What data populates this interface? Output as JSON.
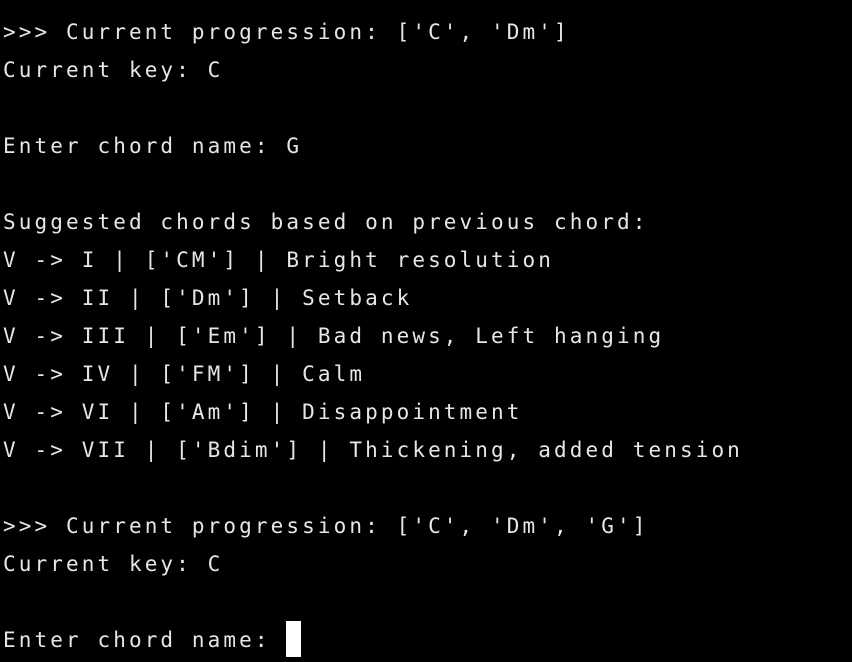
{
  "terminal": {
    "lines": [
      ">>> Current progression: ['C', 'Dm']",
      "Current key: C",
      "",
      "Enter chord name: G",
      "",
      "Suggested chords based on previous chord:",
      "V -> I | ['CM'] | Bright resolution",
      "V -> II | ['Dm'] | Setback",
      "V -> III | ['Em'] | Bad news, Left hanging",
      "V -> IV | ['FM'] | Calm",
      "V -> VI | ['Am'] | Disappointment",
      "V -> VII | ['Bdim'] | Thickening, added tension",
      "",
      ">>> Current progression: ['C', 'Dm', 'G']",
      "Current key: C",
      ""
    ],
    "prompt": "Enter chord name: ",
    "input_value": ""
  },
  "colors": {
    "background": "#000000",
    "text": "#e6e6e6",
    "cursor": "#ffffff"
  }
}
